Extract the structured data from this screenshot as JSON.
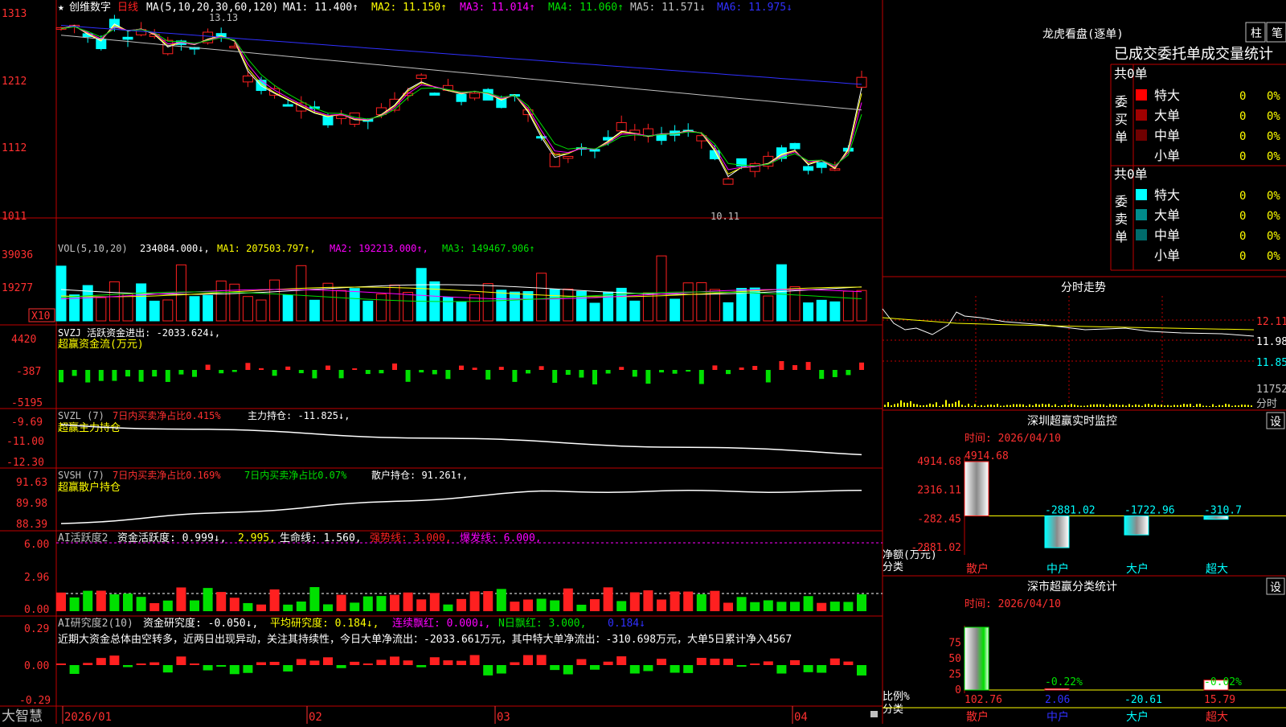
{
  "title_bar": {
    "star": "★",
    "stock_name": "创维数字",
    "period": "日线",
    "ma_label": "MA(5,10,20,30,60,120)",
    "ma_values": [
      {
        "label": "MA1: 11.400↑",
        "color": "#ffffff"
      },
      {
        "label": "MA2: 11.150↑",
        "color": "#ffff00"
      },
      {
        "label": "MA3: 11.014↑",
        "color": "#ff00ff"
      },
      {
        "label": "MA4: 11.060↑",
        "color": "#00e000"
      },
      {
        "label": "MA5: 11.571↓",
        "color": "#c0c0c0"
      },
      {
        "label": "MA6: 11.975↓",
        "color": "#3030ff"
      }
    ]
  },
  "price_panel": {
    "y_ticks": [
      "1313",
      "1212",
      "1112",
      "1011"
    ],
    "high_label": "13.13",
    "low_label": "10.11"
  },
  "vol_panel": {
    "header": "VOL(5,10,20)",
    "value": "234084.000↓,",
    "ma1": "MA1: 207503.797↑,",
    "ma2": "MA2: 192213.000↑,",
    "ma3": "MA3: 149467.906↑",
    "y_ticks": [
      "39036",
      "19277"
    ],
    "unit": "X10"
  },
  "svzj_panel": {
    "header": "SVZJ  活跃资金进出: -2033.624↓,",
    "sub": "超赢资金流(万元)",
    "y_ticks": [
      "4420",
      "-387",
      "-5195"
    ]
  },
  "svzl_panel": {
    "header1": "SVZL (7)",
    "header2": "7日内买卖净占比0.415%",
    "header3": "主力持仓: -11.825↓,",
    "sub": "超赢主力持仓",
    "y_ticks": [
      "-9.69",
      "-11.00",
      "-12.30"
    ]
  },
  "svsh_panel": {
    "header1": "SVSH (7)",
    "header2": "7日内买卖净占比0.169%",
    "header3": "7日内买卖净占比0.07%",
    "header4": "散户持仓: 91.261↑,",
    "sub": "超赢散户持仓",
    "y_ticks": [
      "91.63",
      "89.98",
      "88.39"
    ]
  },
  "ai_active_panel": {
    "header1": "AI活跃度2",
    "header2": "资金活跃度: 0.999↓,",
    "header3": "2.995,",
    "header4": "生命线: 1.560,",
    "header5": "强势线: 3.000,",
    "header6": "爆发线: 6.000,",
    "y_ticks": [
      "6.00",
      "2.96",
      "0.00"
    ]
  },
  "ai_research_panel": {
    "header1": "AI研究度2(10)",
    "header2": "资金研究度: -0.050↓,",
    "header3": "平均研究度: 0.184↓,",
    "header4": "连续飘红: 0.000↓,",
    "header5": "N日飘红: 3.000,",
    "header6": "0.184↓",
    "comment": "近期大资金总体由空转多，近两日出现异动，关注其持续性，今日大单净流出：-2033.661万元，其中特大单净流出：-310.698万元，大单5日累计净入4567",
    "y_ticks": [
      "0.29",
      "0.00",
      "-0.29"
    ]
  },
  "bottom_axis": {
    "logo": "大智慧",
    "dates": [
      "2026/01",
      "02",
      "03",
      "04"
    ]
  },
  "right_panel": {
    "lhb_title": "龙虎看盘(逐单)",
    "tab1": "柱",
    "tab2": "笔",
    "header_row": "已成交委托单成交量统计",
    "buy_label": "委买单",
    "sell_label": "委卖单",
    "buy_total": "共0单",
    "sell_total": "共0单",
    "buy_rows": [
      {
        "name": "特大",
        "count": "0",
        "pct": "0%",
        "color": "#ff0000"
      },
      {
        "name": "大单",
        "count": "0",
        "pct": "0%",
        "color": "#a00000"
      },
      {
        "name": "中单",
        "count": "0",
        "pct": "0%",
        "color": "#700000"
      },
      {
        "name": "小单",
        "count": "0",
        "pct": "0%",
        "color": "#000000"
      }
    ],
    "sell_rows": [
      {
        "name": "特大",
        "count": "0",
        "pct": "0%",
        "color": "#00ffff"
      },
      {
        "name": "大单",
        "count": "0",
        "pct": "0%",
        "color": "#008b8b"
      },
      {
        "name": "中单",
        "count": "0",
        "pct": "0%",
        "color": "#006b6b"
      },
      {
        "name": "小单",
        "count": "0",
        "pct": "0%",
        "color": "#000000"
      }
    ],
    "intraday_title": "分时走势",
    "intraday_ticks": [
      "12.11",
      "11.98",
      "11.85",
      "11752"
    ],
    "intraday_footer": "分时",
    "monitor_title": "深圳超赢实时监控",
    "monitor_set": "设",
    "monitor_time": "时间: 2026/04/10",
    "monitor_yticks": [
      "4914.68",
      "2316.11",
      "-282.45",
      "-2881.02"
    ],
    "monitor_ylabel": "净额(万元)",
    "monitor_xlabel": "分类",
    "class_title": "深市超赢分类统计",
    "class_set": "设",
    "class_time": "时间: 2026/04/10",
    "class_yticks": [
      "75",
      "50",
      "25",
      "0"
    ],
    "class_ylabel": "比例%",
    "class_xlabel": "分类"
  },
  "chart_data": [
    {
      "type": "bar",
      "title": "深圳超赢实时监控",
      "ylabel": "净额(万元)",
      "xlabel": "分类",
      "categories": [
        "散户",
        "中户",
        "大户",
        "超大"
      ],
      "values": [
        4914.68,
        -2881.02,
        -1722.96,
        -310.7
      ],
      "value_labels": [
        "4914.68",
        "-2881.02",
        "-1722.96",
        "-310.7"
      ],
      "ylim": [
        -2881.02,
        4914.68
      ]
    },
    {
      "type": "bar",
      "title": "深市超赢分类统计",
      "ylabel": "比例%",
      "xlabel": "分类",
      "categories": [
        "散户",
        "中户",
        "大户",
        "超大"
      ],
      "values": [
        102.76,
        2.06,
        -20.61,
        15.79
      ],
      "value_labels": [
        "102.76",
        "2.06",
        "-20.61",
        "15.79"
      ],
      "top_labels": [
        "",
        "-0.22%",
        "",
        "-0.02%"
      ],
      "ylim": [
        0,
        100
      ]
    }
  ]
}
